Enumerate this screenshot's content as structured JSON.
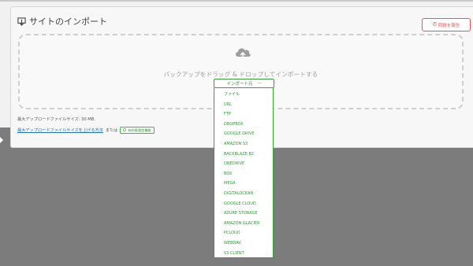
{
  "page": {
    "title": "サイトのインポート",
    "report_button": "問題を報告",
    "drop_text": "バックアップをドラッグ & ドロップしてインポートする",
    "max_upload": "最大アップロードファイルサイズ: 30 MB.",
    "increase_link": "最大アップロードファイルサイズを上げる方法",
    "or_text": "または",
    "plan_badge": "有料版限定機能"
  },
  "dropdown": {
    "label": "インポート元",
    "options": [
      "ファイル",
      "URL",
      "FTP",
      "DROPBOX",
      "GOOGLE DRIVE",
      "AMAZON S3",
      "BACKBLAZE B2",
      "ONEDRIVE",
      "BOX",
      "MEGA",
      "DIGITALOCEAN",
      "GOOGLE CLOUD",
      "AZURE STORAGE",
      "AMAZON GLACIER",
      "PCLOUD",
      "WEBDAV",
      "S3 CLIENT"
    ]
  },
  "colors": {
    "accent_green": "#2e9a35",
    "report_red": "#e05a5a",
    "overlay_gray": "#7c7c7c"
  },
  "icons": {
    "title": "import-icon",
    "report": "warning-circle-icon",
    "upload": "cloud-upload-icon",
    "badge": "lock-icon"
  }
}
